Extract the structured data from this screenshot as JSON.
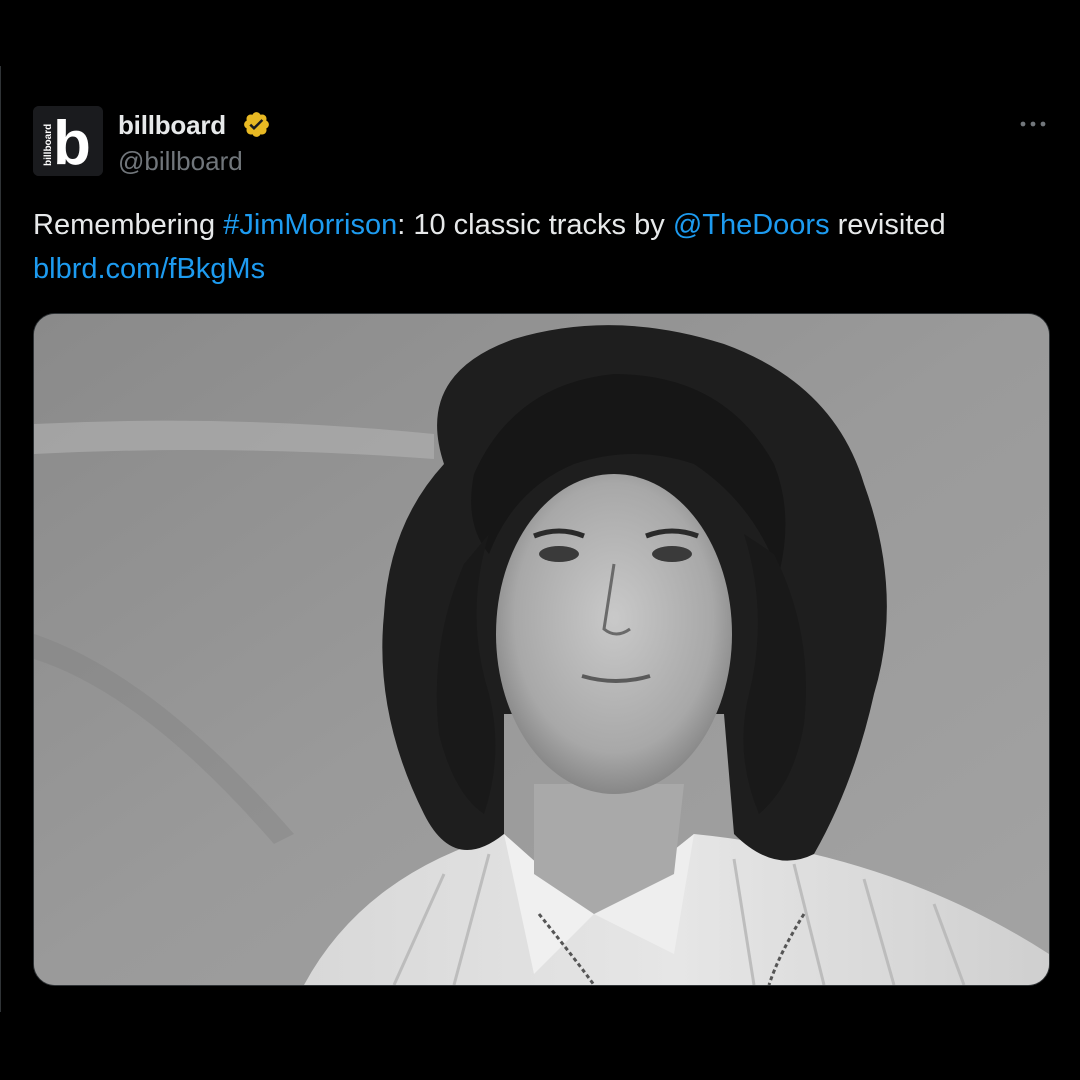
{
  "tweet": {
    "author": {
      "display_name": "billboard",
      "handle": "@billboard",
      "avatar_letter": "b",
      "avatar_wordmark": "billboard",
      "verified": true,
      "verified_color": "#e8b923"
    },
    "more_icon": "more-horizontal-icon",
    "text": {
      "part1": "Remembering ",
      "hashtag": "#JimMorrison",
      "part2": ": 10 classic tracks by ",
      "mention": "@TheDoors",
      "part3": " revisited",
      "url": "blbrd.com/fBkgMs"
    },
    "media": {
      "kind": "black-and-white portrait photo"
    }
  },
  "colors": {
    "background": "#000000",
    "text": "#e7e9ea",
    "muted": "#71767b",
    "link": "#1d9bf0"
  }
}
